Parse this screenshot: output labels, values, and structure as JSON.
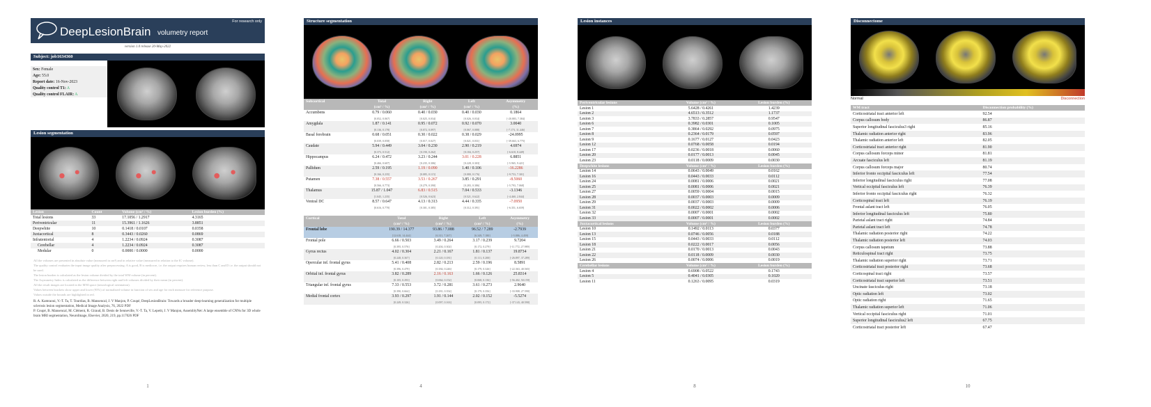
{
  "page1": {
    "for_research": "For research only",
    "title_main": "DeepLesionBrain",
    "title_sub": "volumetry report",
    "version": "version 1.0 release 20-May-2022",
    "subject_bar": "Subject: job1634360",
    "info": [
      {
        "label": "Sex:",
        "value": "Female",
        "cls": ""
      },
      {
        "label": "Age:",
        "value": "55.0",
        "cls": ""
      },
      {
        "label": "Report date:",
        "value": "16-Nov-2023",
        "cls": ""
      },
      {
        "label": "Quality control T1:",
        "value": "A",
        "cls": "grn"
      },
      {
        "label": "Quality control FLAIR:",
        "value": "A",
        "cls": "grn"
      }
    ],
    "lesion_seg_bar": "Lesion segmentation",
    "lesion_headers": [
      "Lesion",
      "Count",
      "Volume (cm³ / %)",
      "Lesion burden (%)"
    ],
    "lesion_rows": [
      [
        "Total lesions",
        "33",
        "17.1056 / 1.2917",
        "4.3165"
      ],
      [
        "Periventricular",
        "11",
        "15.3961 / 1.1626",
        "3.8851"
      ],
      [
        "Deepwhite",
        "10",
        "0.1418 / 0.0107",
        "0.0358"
      ],
      [
        "Juxtacortical",
        "8",
        "0.3443 / 0.0260",
        "0.0869"
      ],
      [
        "Infratentorial",
        "4",
        "1.2234 / 0.0924",
        "0.3087"
      ],
      [
        "Cerebellar",
        "4",
        "1.2234 / 0.0924",
        "0.3087"
      ],
      [
        "Medular",
        "0",
        "0.0000 / 0.0000",
        "0.0000"
      ]
    ],
    "notes": [
      "All the volumes are presented in absolute value (measured in cm³) and in relative value (measured in relation to the IC volume).",
      "The quality control evaluates the input image quality after preprocessing: A is good, B is mediocre, i.e. the output requires human review, less than C and D i.e. the output should not be used.",
      "The lesion burden is calculated as the lesion volume divided by the total WM volume (in percent).",
      "The Asymmetry Index is calculated as the difference between right and left volumes divided by their mean (in percent).",
      "All the result images are located in the MNI space (neurological orientation).",
      "Values between brackets show upper and lower (95%) of normalized volume in function of sex and age for each measure for reference purpose.",
      "Values outside the bounds are highlighted in red."
    ],
    "refs": [
      "R. A. Kamraoui, V.-T. Ta, T. Tourdias, B. Mansencal, J. V Manjon, P. Coupé, DeepLesionBrain: Towards a broader deep-learning generalization for multiple sclerosis lesion segmentation, Medical Image Analysis, 76, 2022 PDF",
      "P. Coupé, B. Mansencal, M. Clément, R. Giraud, B. Denis de Senneville, V.-T. Ta, V. Lepetit, J. V Manjon, AssemblyNet: A large ensemble of CNNs for 3D whole brain MRI segmentation, NeuroImage, Elsevier, 2020, 219, pp.117026 PDF"
    ],
    "page_num": "1"
  },
  "page4": {
    "bar": "Structure segmentation",
    "sub_headers": [
      "Subcortical",
      "Total",
      "Right",
      "Left",
      "Asymmetry"
    ],
    "sub_units": [
      "",
      "(cm³ / %)",
      "(cm³ / %)",
      "(cm³ / %)",
      "(%)"
    ],
    "sub_rows": [
      {
        "name": "Accumbens",
        "vals": [
          "0.79 / 0.060",
          "0.40 / 0.030",
          "0.40 / 0.030",
          "0.1864"
        ],
        "rng": [
          "[0.052, 0.067]",
          "[0.025, 0.034]",
          "[0.026, 0.034]",
          "[-20.883, 7.384]"
        ],
        "red": []
      },
      {
        "name": "Amygdala",
        "vals": [
          "1.87 / 0.141",
          "0.95 / 0.072",
          "0.92 / 0.070",
          "3.0040"
        ],
        "rng": [
          "[0.136, 0.178]",
          "[0.072, 0.097]",
          "[0.067, 0.088]",
          "[-7.173, 11.446]"
        ],
        "red": []
      },
      {
        "name": "Basal forebrain",
        "vals": [
          "0.68 / 0.051",
          "0.30 / 0.022",
          "0.38 / 0.029",
          "-24.0995"
        ],
        "rng": [
          "[0.039, 0.058]",
          "[0.017, 0.027]",
          "[0.021, 0.031]",
          "[-39.663, 6.775]"
        ],
        "red": []
      },
      {
        "name": "Caudate",
        "vals": [
          "5.94 / 0.449",
          "3.04 / 0.230",
          "2.90 / 0.219",
          "4.6974"
        ],
        "rng": [
          "[0.373, 0.512]",
          "[0.190, 0.262]",
          "[0.184, 0.257]",
          "[-6.618, 8.449]"
        ],
        "red": []
      },
      {
        "name": "Hippocampus",
        "vals": [
          "6.24 / 0.472",
          "3.23 / 0.244",
          "3.01 / 0.228",
          "6.8851"
        ],
        "rng": [
          "[0.466, 0.607]",
          "[0.235, 0.306]",
          "[0.228, 0.303]",
          "[-5.965, 9.421]"
        ],
        "red": [
          2
        ]
      },
      {
        "name": "Pallidum",
        "vals": [
          "2.59 / 0.195",
          "1.19 / 0.090",
          "1.40 / 0.106",
          "-16.2286"
        ],
        "rng": [
          "[0.166, 0.235]",
          "[0.085, 0.115]",
          "[0.080, 0.176]",
          "[-9.753, 7.301]"
        ],
        "red": [
          1,
          3
        ]
      },
      {
        "name": "Putamen",
        "vals": [
          "7.38 / 0.557",
          "3.53 / 0.267",
          "3.85 / 0.291",
          "-8.5060"
        ],
        "rng": [
          "[0.566, 0.773]",
          "[0.279, 0.390]",
          "[0.283, 0.386]",
          "[-5.793, 7.068]"
        ],
        "red": [
          0,
          1,
          3
        ]
      },
      {
        "name": "Thalamus",
        "vals": [
          "15.87 / 1.047",
          "6.83 / 0.515",
          "7.04 / 0.533",
          "-3.1346"
        ],
        "rng": [
          "[1.045, 1.235]",
          "[0.526, 0.623]",
          "[0.521, 0.622]",
          "[-4.460, 2.844]"
        ],
        "red": [
          1
        ]
      },
      {
        "name": "Ventral DC",
        "vals": [
          "8.57 / 0.647",
          "4.13 / 0.313",
          "4.44 / 0.335",
          "-7.0950"
        ],
        "rng": [
          "[0.616, 0.770]",
          "[0.301, 0.385]",
          "[0.312, 0.391]",
          "[-6.351, 6.659]"
        ],
        "red": [
          3
        ]
      }
    ],
    "cort_headers": [
      "Cortical",
      "Total",
      "Right",
      "Left",
      "Asymmetry"
    ],
    "cort_units": [
      "",
      "(cm³ / %)",
      "(cm³ / %)",
      "(cm³ / %)",
      "(%)"
    ],
    "frontal": {
      "name": "Frontal lobe",
      "vals": [
        "190.39 / 14.377",
        "93.86 / 7.088",
        "96.52 / 7.289",
        "-2.7939"
      ],
      "rng": [
        "[12.618, 14.444]",
        "[6.311, 7.267]",
        "[6.349, 7.180]",
        "[-5.886, 4.459]"
      ]
    },
    "cort_rows": [
      {
        "name": "Frontal pole",
        "vals": [
          "6.66 / 0.503",
          "3.49 / 0.264",
          "3.17 / 0.239",
          "9.7204"
        ],
        "rng": [
          "[0.395, 0.576]",
          "[0.204, 0.302]",
          "[0.172, 0.279]",
          "[-11.772, 27.989]"
        ],
        "red": []
      },
      {
        "name": "Gyrus rectus",
        "vals": [
          "4.02 / 0.304",
          "2.21 / 0.167",
          "1.81 / 0.137",
          "19.8734"
        ],
        "rng": [
          "[0.248, 0.367]",
          "[0.120, 0.181]",
          "[0.111, 0.200]",
          "[-26.897, 37.289]"
        ],
        "red": []
      },
      {
        "name": "Opercular inf. frontal gyrus",
        "vals": [
          "5.41 / 0.408",
          "2.82 / 0.213",
          "2.59 / 0.196",
          "8.5891"
        ],
        "rng": [
          "[0.396, 0.479]",
          "[0.184, 0.246]",
          "[0.179, 0.326]",
          "[-22.363, 40.565]"
        ],
        "red": []
      },
      {
        "name": "Orbital inf. frontal gyrus",
        "vals": [
          "3.82 / 0.289",
          "2.16 / 0.163",
          "1.66 / 0.126",
          "25.8314"
        ],
        "rng": [
          "[0.105, 0.293]",
          "[0.064, 0.152]",
          "[0.068, 0.136]",
          "[-56.402, 50.159]"
        ],
        "red": [
          1
        ]
      },
      {
        "name": "Triangular inf. frontal gyrus",
        "vals": [
          "7.33 / 0.553",
          "3.72 / 0.281",
          "3.61 / 0.273",
          "2.9640"
        ],
        "rng": [
          "[0.390, 0.664]",
          "[0.181, 0.354]",
          "[0.179, 0.356]",
          "[-33.908, 27.590]"
        ],
        "red": []
      },
      {
        "name": "Medial frontal cortex",
        "vals": [
          "3.93 / 0.297",
          "1.91 / 0.144",
          "2.02 / 0.152",
          "-5.5274"
        ],
        "rng": [
          "[0.249, 0.326]",
          "[0.097, 0.163]",
          "[0.095, 0.172]",
          "[-37.143, 40.590]"
        ],
        "red": []
      }
    ],
    "page_num": "4"
  },
  "page8": {
    "bar": "Lesion instances",
    "sections": [
      {
        "headers": [
          "Periventricular lesions",
          "Volume (cm³ / %)",
          "Lesion burden (%)"
        ],
        "rows": [
          [
            "Lesion 1",
            "5.6428 / 0.4261",
            "1.4239"
          ],
          [
            "Lesion 2",
            "4.6513 / 0.3512",
            "1.1737"
          ],
          [
            "Lesion 3",
            "3.7833 / 0.2857",
            "0.9547"
          ],
          [
            "Lesion 6",
            "0.3982 / 0.0301",
            "0.1005"
          ],
          [
            "Lesion 7",
            "0.3864 / 0.0292",
            "0.0975"
          ],
          [
            "Lesion 8",
            "0.2364 / 0.0179",
            "0.0597"
          ],
          [
            "Lesion 9",
            "0.1677 / 0.0127",
            "0.0423"
          ],
          [
            "Lesion 12",
            "0.0768 / 0.0058",
            "0.0194"
          ],
          [
            "Lesion 17",
            "0.0236 / 0.0018",
            "0.0060"
          ],
          [
            "Lesion 20",
            "0.0177 / 0.0013",
            "0.0045"
          ],
          [
            "Lesion 23",
            "0.0118 / 0.0009",
            "0.0030"
          ]
        ]
      },
      {
        "headers": [
          "Deepwhite lesions",
          "Volume (cm³ / %)",
          "Lesion burden (%)"
        ],
        "rows": [
          [
            "Lesion 14",
            "0.0643 / 0.0049",
            "0.0162"
          ],
          [
            "Lesion 16",
            "0.0443 / 0.0033",
            "0.0112"
          ],
          [
            "Lesion 24",
            "0.0081 / 0.0006",
            "0.0021"
          ],
          [
            "Lesion 25",
            "0.0081 / 0.0006",
            "0.0021"
          ],
          [
            "Lesion 27",
            "0.0059 / 0.0004",
            "0.0015"
          ],
          [
            "Lesion 28",
            "0.0037 / 0.0003",
            "0.0009"
          ],
          [
            "Lesion 29",
            "0.0037 / 0.0003",
            "0.0009"
          ],
          [
            "Lesion 31",
            "0.0022 / 0.0002",
            "0.0006"
          ],
          [
            "Lesion 32",
            "0.0007 / 0.0001",
            "0.0002"
          ],
          [
            "Lesion 33",
            "0.0007 / 0.0001",
            "0.0002"
          ]
        ]
      },
      {
        "headers": [
          "Juxtacortical lesions",
          "Volume (cm³ / %)",
          "Lesion burden (%)"
        ],
        "rows": [
          [
            "Lesion 10",
            "0.1492 / 0.0113",
            "0.0377"
          ],
          [
            "Lesion 13",
            "0.0746 / 0.0056",
            "0.0188"
          ],
          [
            "Lesion 15",
            "0.0443 / 0.0033",
            "0.0112"
          ],
          [
            "Lesion 18",
            "0.0222 / 0.0017",
            "0.0056"
          ],
          [
            "Lesion 21",
            "0.0170 / 0.0013",
            "0.0043"
          ],
          [
            "Lesion 22",
            "0.0118 / 0.0009",
            "0.0030"
          ],
          [
            "Lesion 26",
            "0.0074 / 0.0006",
            "0.0019"
          ]
        ]
      },
      {
        "headers": [
          "Cerebellar lesions",
          "Volume (cm³ / %)",
          "Lesion burden (%)"
        ],
        "rows": [
          [
            "Lesion 4",
            "0.6908 / 0.0522",
            "0.1743"
          ],
          [
            "Lesion 5",
            "0.4041 / 0.0305",
            "0.1020"
          ],
          [
            "Lesion 11",
            "0.1263 / 0.0095",
            "0.0319"
          ]
        ]
      }
    ],
    "page_num": "8"
  },
  "page10": {
    "bar": "Disconnectome",
    "scale_left": "Normal",
    "scale_right": "Disconnection",
    "headers": [
      "WM tract",
      "Disconnection probability (%)"
    ],
    "rows": [
      [
        "Corticostriatal tract anterior left",
        "92.54"
      ],
      [
        "Corpus callosum body",
        "86.87"
      ],
      [
        "Superior longitudinal fasciculus3 right",
        "85.16"
      ],
      [
        "Thalamic radiation anterior right",
        "83.96"
      ],
      [
        "Thalamic radiation anterior left",
        "82.05"
      ],
      [
        "Corticostriatal tract anterior right",
        "81.90"
      ],
      [
        "Corpus callosum forceps minor",
        "81.81"
      ],
      [
        "Arcuate fasciculus left",
        "81.19"
      ],
      [
        "Corpus callosum forceps major",
        "80.74"
      ],
      [
        "Inferior fronto occipital fasciculus left",
        "77.54"
      ],
      [
        "Inferior longitudinal fasciculus right",
        "77.08"
      ],
      [
        "Vertical occipital fasciculus left",
        "76.39"
      ],
      [
        "Inferior fronto occipital fasciculus right",
        "76.32"
      ],
      [
        "Corticospinal tract left",
        "76.19"
      ],
      [
        "Frontal aslant tract left",
        "76.05"
      ],
      [
        "Inferior longitudinal fasciculus left",
        "75.80"
      ],
      [
        "Parietal aslant tract right",
        "74.84"
      ],
      [
        "Parietal aslant tract left",
        "74.78"
      ],
      [
        "Thalamic radiation posterior right",
        "74.22"
      ],
      [
        "Thalamic radiation posterior left",
        "74.03"
      ],
      [
        "Corpus callosum tapetum",
        "73.88"
      ],
      [
        "Reticulospinal tract right",
        "73.75"
      ],
      [
        "Thalamic radiation superior right",
        "73.71"
      ],
      [
        "Corticostriatal tract posterior right",
        "73.68"
      ],
      [
        "Corticospinal tract right",
        "73.57"
      ],
      [
        "Corticostriatal tract superior left",
        "73.51"
      ],
      [
        "Uncinate fasciculus right",
        "73.18"
      ],
      [
        "Optic radiation left",
        "73.02"
      ],
      [
        "Optic radiation right",
        "71.65"
      ],
      [
        "Thalamic radiation superior left",
        "71.06"
      ],
      [
        "Vertical occipital fasciculus right",
        "71.01"
      ],
      [
        "Superior longitudinal fasciculus2 left",
        "67.75"
      ],
      [
        "Corticostriatal tract posterior left",
        "67.47"
      ]
    ],
    "page_num": "10"
  }
}
